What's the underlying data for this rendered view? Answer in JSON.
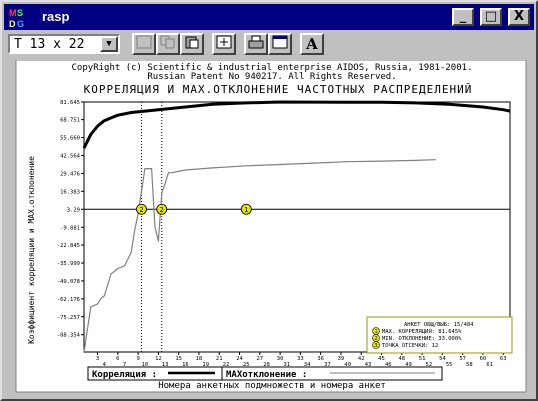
{
  "window": {
    "title": "rasp",
    "icon_letters": [
      "M",
      "S",
      "D",
      "G"
    ],
    "buttons": {
      "minimize": "_",
      "maximize": "□",
      "close": "X"
    }
  },
  "toolbar": {
    "font_size_value": "T 13 x 22",
    "dropdown_glyph": "▼",
    "text_tool_glyph": "A"
  },
  "chart": {
    "copyright": "CopyRight (c) Scientific & industrial enterprise AIDOS, Russia, 1981-2001.",
    "patent": "Russian Patent No 940217. All Rights Reserved.",
    "title": "КОРРЕЛЯЦИЯ И MAX.ОТКЛОНЕНИЕ ЧАСТОТНЫХ РАСПРЕДЕЛЕНИЙ",
    "ylabel": "Коэффициент корреляции и MAX.отклонение",
    "xlabel": "Номера анкетных подмножеств и номера анкет",
    "info_box": {
      "lines": [
        "АНКЕТ ОБЩ/ВЫБ: 15/484",
        "MAX. КОРРЕЛЯЦИЯ: 81.645%",
        "MIN. ОТКЛОНЕНИЕ: 33.000%",
        "ТОЧКА ОТСЕЧКИ: 12"
      ],
      "markers": [
        "1",
        "2",
        "3"
      ]
    },
    "legend": {
      "correlation_label": "Корреляция :",
      "deviation_label": "MAXотклонение :"
    },
    "markers": [
      "2",
      "2",
      "1"
    ],
    "colors": {
      "correlation": "#000000",
      "deviation": "#808080",
      "marker": "#e6e600"
    }
  },
  "chart_data": {
    "type": "line",
    "yticks": [
      "81.645",
      "68.751",
      "55.660",
      "42.564",
      "29.476",
      "16.383",
      "3.29",
      "-9.881",
      "-22.845",
      "-35.999",
      "-49.078",
      "-62.176",
      "-75.257",
      "-88.354"
    ],
    "xticks_top": [
      "3",
      "6",
      "9",
      "12",
      "15",
      "18",
      "21",
      "24",
      "27",
      "30",
      "33",
      "36",
      "39",
      "42",
      "45",
      "48",
      "51",
      "54",
      "57",
      "60",
      "63"
    ],
    "xticks_bottom": [
      "4",
      "7",
      "10",
      "13",
      "16",
      "19",
      "22",
      "25",
      "28",
      "31",
      "34",
      "37",
      "40",
      "43",
      "46",
      "49",
      "52",
      "55",
      "58",
      "61"
    ],
    "xlim": [
      1,
      64
    ],
    "ylim": [
      -101,
      81.645
    ],
    "baseline": 3.29,
    "marker_x": [
      9.5,
      12.5,
      25
    ],
    "series": [
      {
        "name": "Корреляция",
        "x": [
          1,
          2,
          3,
          4,
          5,
          6,
          8,
          10,
          12,
          14,
          16,
          18,
          20,
          25,
          30,
          35,
          40,
          45,
          50,
          55,
          60,
          63,
          64
        ],
        "values": [
          48,
          58,
          64,
          68,
          70,
          72,
          74,
          75,
          76,
          77,
          78,
          79,
          80,
          81,
          81.645,
          81.6,
          81.5,
          81.4,
          81,
          80,
          78,
          76,
          75
        ]
      },
      {
        "name": "MAXотклонение",
        "x": [
          1,
          2,
          3,
          3.5,
          4,
          5,
          6,
          7,
          8,
          8.5,
          9,
          10,
          11,
          11.5,
          12,
          12.5,
          13,
          13.5,
          14,
          16,
          20,
          25,
          30,
          35,
          40,
          45,
          50,
          53
        ],
        "values": [
          -101,
          -68,
          -66,
          -62,
          -60,
          -44,
          -40,
          -38,
          -28,
          -12,
          0,
          33,
          33,
          -10,
          -20,
          15,
          22,
          30,
          30,
          32,
          33.5,
          35,
          36,
          37,
          38,
          38.5,
          39,
          39.5
        ]
      }
    ]
  }
}
